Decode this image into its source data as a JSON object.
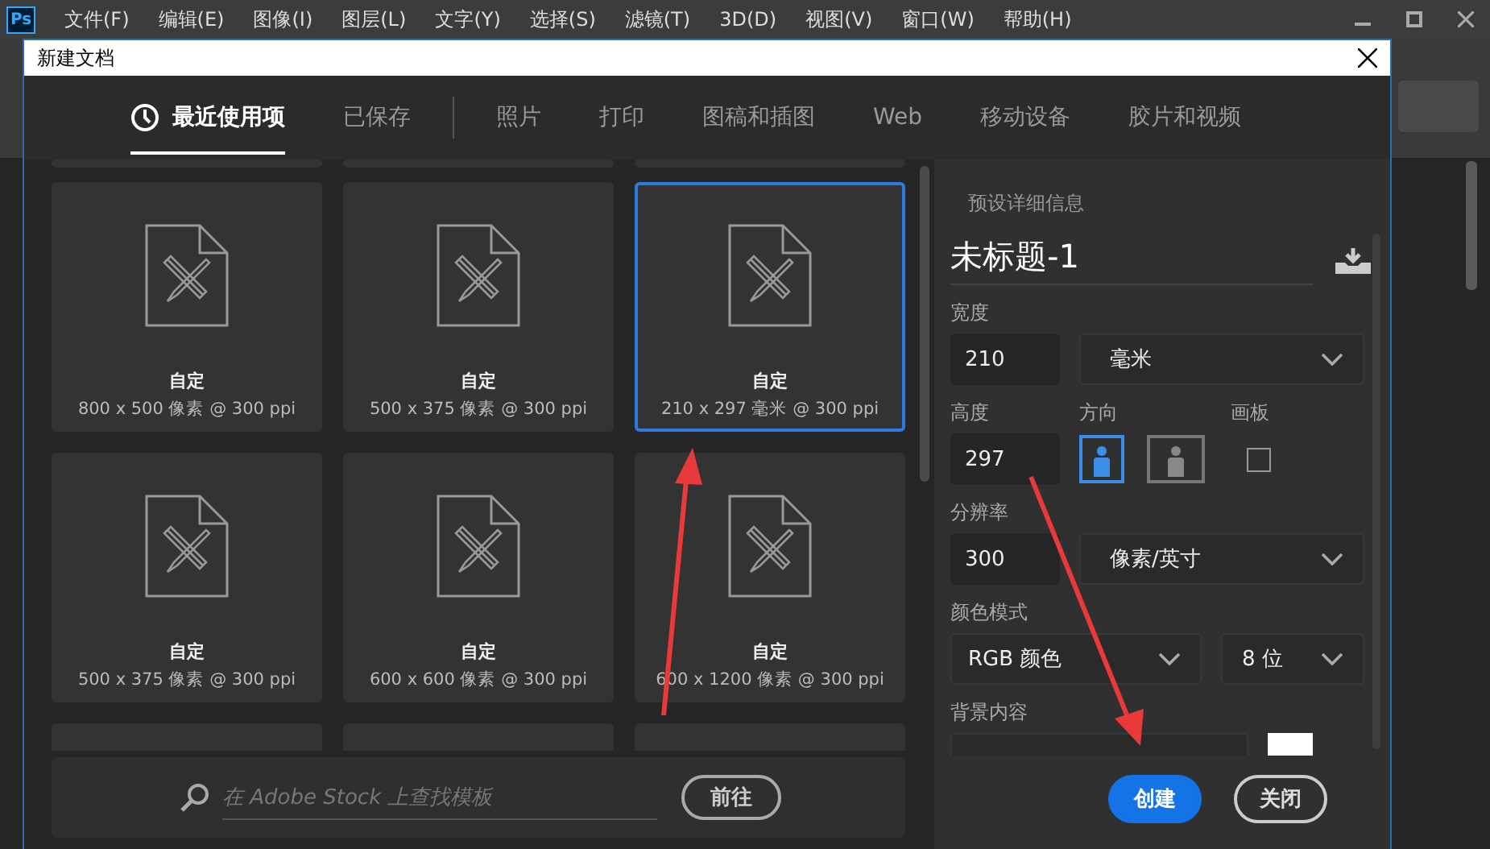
{
  "app": {
    "logo": "Ps",
    "menu": [
      "文件(F)",
      "编辑(E)",
      "图像(I)",
      "图层(L)",
      "文字(Y)",
      "选择(S)",
      "滤镜(T)",
      "3D(D)",
      "视图(V)",
      "窗口(W)",
      "帮助(H)"
    ]
  },
  "dialog": {
    "title": "新建文档",
    "tabs": [
      {
        "label": "最近使用项",
        "selected": true,
        "kind": "recent",
        "divider_after": false
      },
      {
        "label": "已保存",
        "selected": false,
        "kind": "plain",
        "divider_after": true
      },
      {
        "label": "照片",
        "selected": false,
        "kind": "plain",
        "divider_after": false
      },
      {
        "label": "打印",
        "selected": false,
        "kind": "plain",
        "divider_after": false
      },
      {
        "label": "图稿和插图",
        "selected": false,
        "kind": "plain",
        "divider_after": false
      },
      {
        "label": "Web",
        "selected": false,
        "kind": "plain",
        "divider_after": false
      },
      {
        "label": "移动设备",
        "selected": false,
        "kind": "plain",
        "divider_after": false
      },
      {
        "label": "胶片和视频",
        "selected": false,
        "kind": "plain",
        "divider_after": false
      }
    ],
    "presets": [
      {
        "title": "自定",
        "size": "800 x 500 像素 @ 300 ppi",
        "selected": false
      },
      {
        "title": "自定",
        "size": "500 x 375 像素 @ 300 ppi",
        "selected": false
      },
      {
        "title": "自定",
        "size": "210 x 297 毫米 @ 300 ppi",
        "selected": true
      },
      {
        "title": "自定",
        "size": "500 x 375 像素 @ 300 ppi",
        "selected": false
      },
      {
        "title": "自定",
        "size": "600 x 600 像素 @ 300 ppi",
        "selected": false
      },
      {
        "title": "自定",
        "size": "600 x 1200 像素 @ 300 ppi",
        "selected": false
      }
    ],
    "search": {
      "placeholder": "在 Adobe Stock 上查找模板",
      "button": "前往"
    },
    "details": {
      "heading": "预设详细信息",
      "name": "未标题-1",
      "width": {
        "label": "宽度",
        "value": "210",
        "unit": "毫米"
      },
      "height": {
        "label": "高度",
        "value": "297"
      },
      "orientation": {
        "label": "方向",
        "options": [
          {
            "kind": "portrait",
            "selected": true
          },
          {
            "kind": "landscape",
            "selected": false
          }
        ]
      },
      "artboard": {
        "label": "画板",
        "checked": false
      },
      "resolution": {
        "label": "分辨率",
        "value": "300",
        "unit": "像素/英寸"
      },
      "color_mode": {
        "label": "颜色模式",
        "mode": "RGB 颜色",
        "depth": "8 位"
      },
      "background": {
        "label": "背景内容"
      }
    },
    "buttons": [
      {
        "label": "创建",
        "kind": "primary"
      },
      {
        "label": "关闭",
        "kind": "secondary"
      }
    ]
  }
}
